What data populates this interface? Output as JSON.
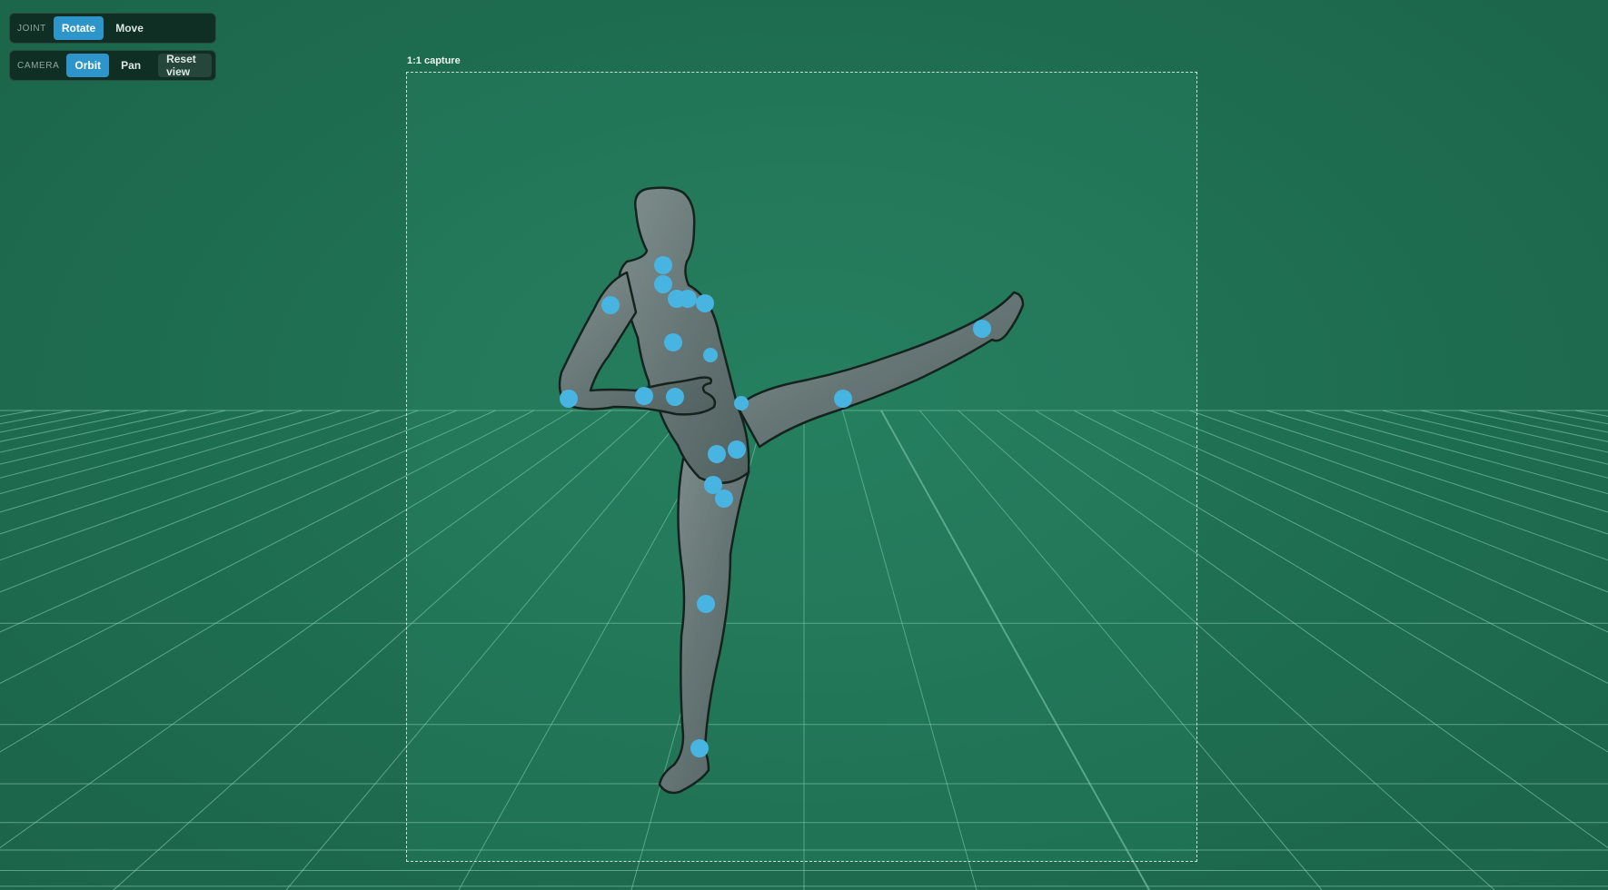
{
  "joint_toolbar": {
    "label": "JOINT",
    "modes": [
      "Rotate",
      "Move"
    ],
    "active": "Rotate"
  },
  "camera_toolbar": {
    "label": "CAMERA",
    "modes": [
      "Orbit",
      "Pan"
    ],
    "active": "Orbit",
    "reset_label": "Reset view"
  },
  "capture": {
    "label": "1:1 capture"
  },
  "colors": {
    "background": "#1d6a4f",
    "grid": "#8fd6bd",
    "joint_handle": "#4ab6ef",
    "figure": "#6b6d72",
    "active_button": "#2d95c9"
  },
  "figure": {
    "joint_count": 20
  }
}
